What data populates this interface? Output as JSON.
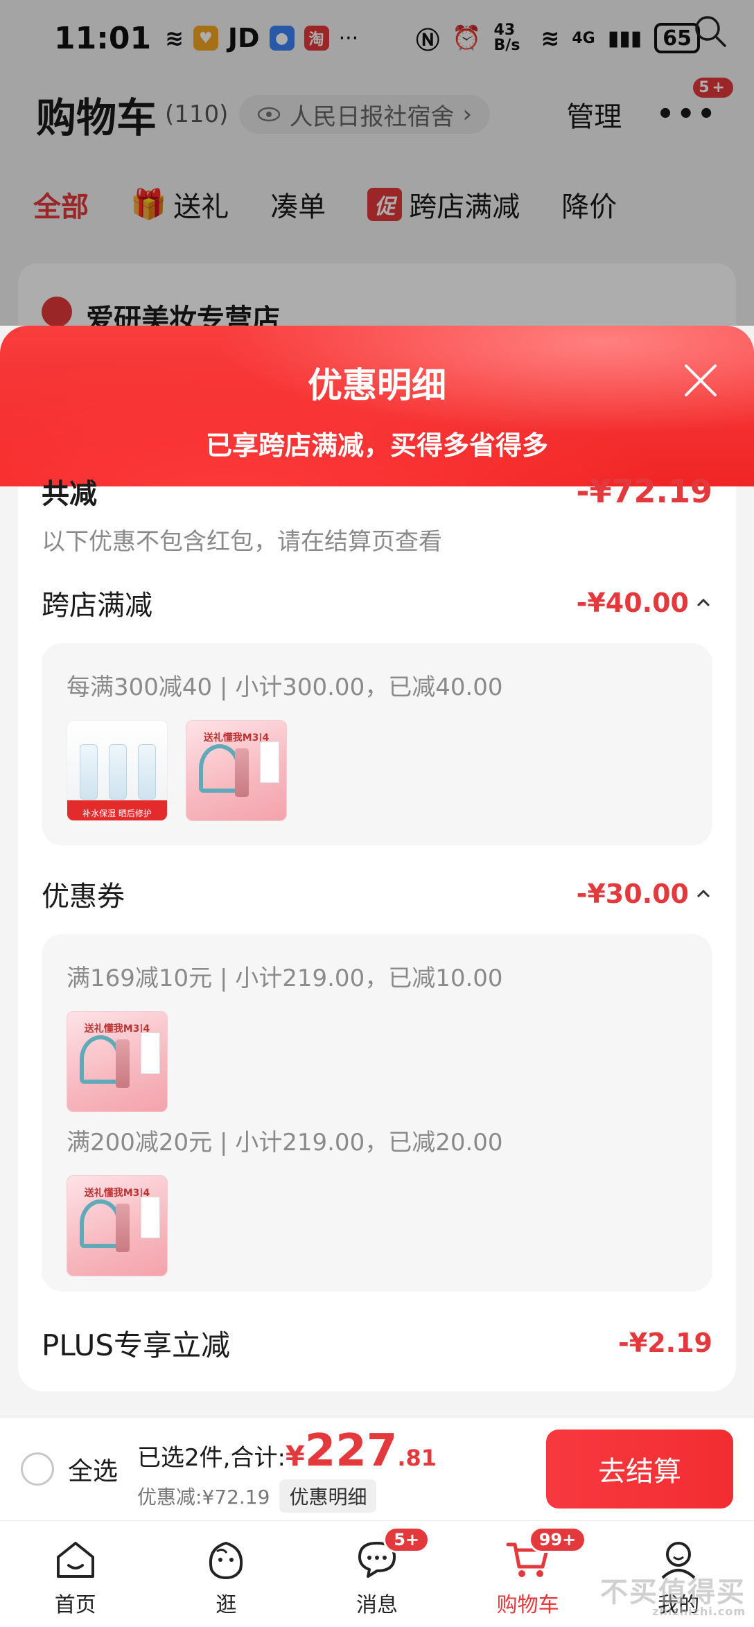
{
  "status_bar": {
    "time": "11:01",
    "jd": "JD",
    "net_speed": "43 B/s",
    "network": "4G",
    "battery": "65"
  },
  "header": {
    "title": "购物车",
    "count": "(110)",
    "address": "人民日报社宿舍",
    "manage": "管理",
    "more_badge": "5+"
  },
  "tabs": [
    {
      "label": "全部"
    },
    {
      "label": "送礼"
    },
    {
      "label": "凑单"
    },
    {
      "label": "跨店满减",
      "tag": "促"
    },
    {
      "label": "降价"
    }
  ],
  "store": {
    "name": "爱研美妆专营店"
  },
  "sheet": {
    "title": "优惠明细",
    "subtitle": "已享跨店满减，买得多省得多",
    "total_label": "共减",
    "total_value": "-¥72.19",
    "note": "以下优惠不包含红包，请在结算页查看",
    "sections": {
      "cross_store": {
        "label": "跨店满减",
        "value": "-¥40.00",
        "line": "每满300减40 | 小计300.00，已减40.00"
      },
      "coupon": {
        "label": "优惠券",
        "value": "-¥30.00",
        "line1": "满169减10元 | 小计219.00，已减10.00",
        "line2": "满200减20元 | 小计219.00，已减20.00"
      },
      "plus": {
        "label": "PLUS专享立减",
        "value": "-¥2.19"
      }
    },
    "product_thumb_texts": {
      "cream_strip": "补水保湿 晒后修护",
      "gift_title": "送礼懂我M3|4"
    }
  },
  "checkout": {
    "select_all": "全选",
    "selected_text": "已选2件,合计:",
    "currency": "¥",
    "total_int": "227",
    "total_dec": ".81",
    "discount_text": "优惠减:¥72.19",
    "detail_chip": "优惠明细",
    "button": "去结算"
  },
  "nav": [
    {
      "label": "首页",
      "icon": "home-icon"
    },
    {
      "label": "逛",
      "icon": "explore-icon"
    },
    {
      "label": "消息",
      "icon": "message-icon",
      "badge": "5+"
    },
    {
      "label": "购物车",
      "icon": "cart-icon",
      "badge": "99+",
      "active": true
    },
    {
      "label": "我的",
      "icon": "profile-icon"
    }
  ],
  "watermark": {
    "text": "不买值得买",
    "url": "zhizhizhi.com"
  },
  "colors": {
    "accent": "#e4393c",
    "sheet_gradient": "#f93d3d"
  }
}
